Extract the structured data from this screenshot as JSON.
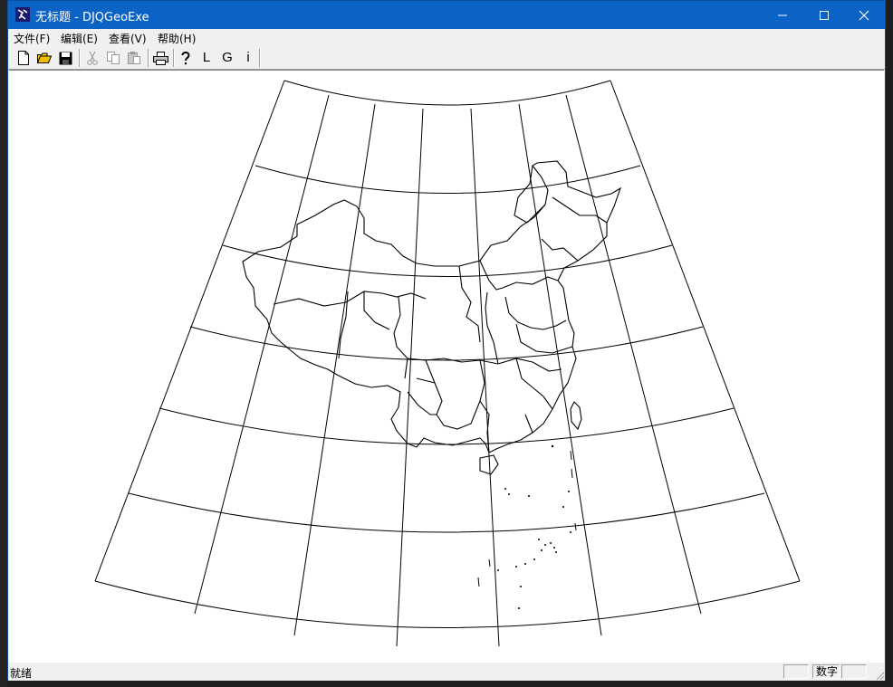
{
  "window": {
    "title": "无标题 - DJQGeoExe",
    "app_icon": "djqgeo-app-icon",
    "controls": [
      "minimize-icon",
      "maximize-icon",
      "close-icon"
    ]
  },
  "menu": {
    "items": [
      {
        "label": "文件(F)"
      },
      {
        "label": "编辑(E)"
      },
      {
        "label": "查看(V)"
      },
      {
        "label": "帮助(H)"
      }
    ]
  },
  "toolbar": {
    "buttons": [
      {
        "icon": "new-file-icon",
        "enabled": true
      },
      {
        "icon": "open-folder-icon",
        "enabled": true
      },
      {
        "icon": "save-disk-icon",
        "enabled": true
      },
      {
        "icon": "cut-icon",
        "enabled": false
      },
      {
        "icon": "copy-icon",
        "enabled": false
      },
      {
        "icon": "paste-icon",
        "enabled": false
      },
      {
        "icon": "print-icon",
        "enabled": true
      },
      {
        "icon": "help-icon",
        "enabled": true
      }
    ],
    "letter_buttons": [
      "L",
      "G",
      "i"
    ]
  },
  "map": {
    "description_type": "conic projection graticule with China province boundaries",
    "line_color": "#000000",
    "background": "#ffffff"
  },
  "status": {
    "text": "就绪",
    "panes": [
      "",
      "数字",
      ""
    ]
  },
  "colors": {
    "titlebar": "#0b63c6",
    "chrome": "#f0f0f0"
  }
}
